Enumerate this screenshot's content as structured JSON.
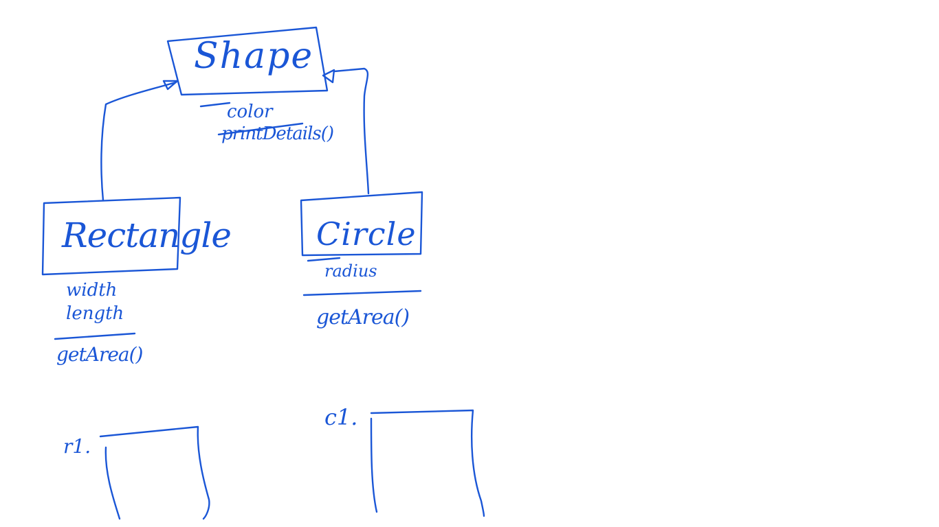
{
  "diagram": {
    "shape_class": {
      "title": "Shape",
      "attributes": [
        "color"
      ],
      "methods": [
        "printDetails()"
      ]
    },
    "rectangle_class": {
      "title": "Rectangle",
      "attributes": [
        "width",
        "length"
      ],
      "methods": [
        "getArea()"
      ]
    },
    "circle_class": {
      "title": "Circle",
      "attributes": [
        "radius"
      ],
      "methods": [
        "getArea()"
      ]
    },
    "objects": {
      "r1_label": "r1.",
      "c1_label": "c1."
    },
    "ink_color": "#1a56d6"
  }
}
